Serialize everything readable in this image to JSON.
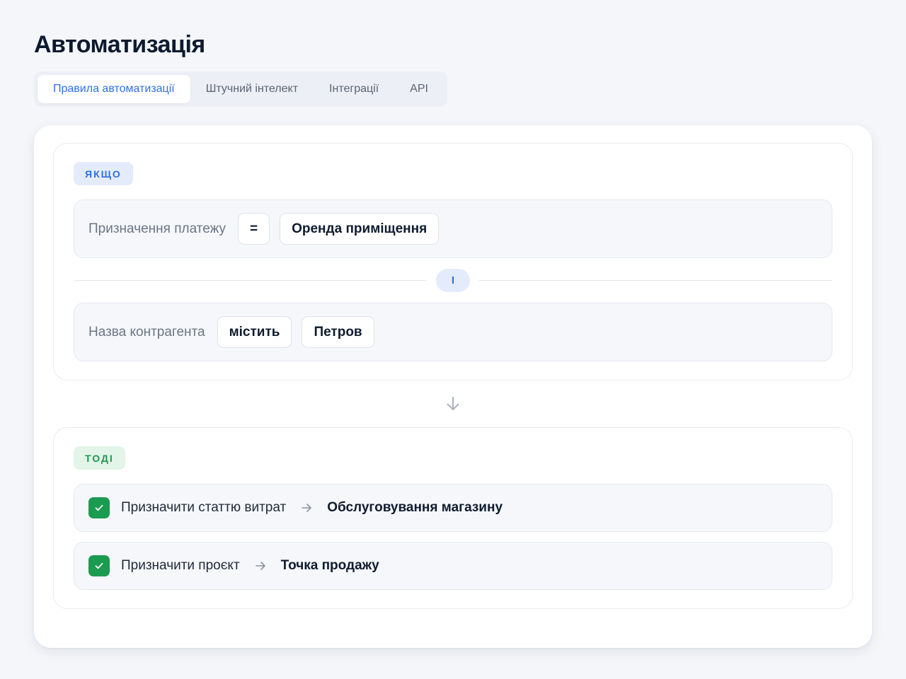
{
  "page": {
    "title": "Автоматизація"
  },
  "tabs": [
    {
      "label": "Правила автоматизації",
      "active": true
    },
    {
      "label": "Штучний інтелект",
      "active": false
    },
    {
      "label": "Інтеграції",
      "active": false
    },
    {
      "label": "API",
      "active": false
    }
  ],
  "rule": {
    "if_label": "ЯКЩО",
    "conditions": [
      {
        "field": "Призначення платежу",
        "operator": "=",
        "value": "Оренда приміщення"
      },
      {
        "field": "Назва контрагента",
        "operator": "містить",
        "value": "Петров"
      }
    ],
    "joiner": "І",
    "then_label": "ТОДІ",
    "actions": [
      {
        "label": "Призначити статтю витрат",
        "value": "Обслуговування магазину",
        "checked": true
      },
      {
        "label": "Призначити проєкт",
        "value": "Точка продажу",
        "checked": true
      }
    ]
  },
  "colors": {
    "accent": "#2f6fe4",
    "success": "#1a9b50",
    "background": "#f4f6fa"
  },
  "icons": {
    "flow_arrow": "arrow-down-icon",
    "action_arrow": "arrow-right-icon",
    "checkbox": "check-icon"
  }
}
